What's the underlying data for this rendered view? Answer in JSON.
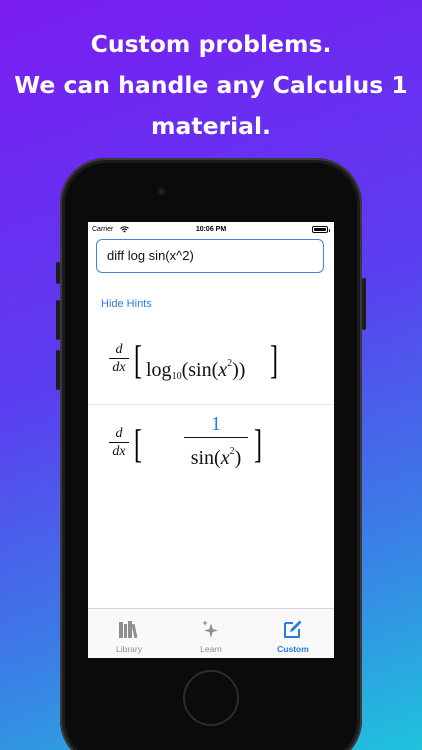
{
  "headline": {
    "line1": "Custom problems.",
    "line2": "We can handle any Calculus 1",
    "line3": "material."
  },
  "status_bar": {
    "carrier": "Carrier",
    "time": "10:06 PM"
  },
  "input": {
    "value": "diff log sin(x^2)"
  },
  "hints_toggle": "Hide Hints",
  "problem": {
    "d": "d",
    "dx": "dx",
    "log": "log",
    "base": "10",
    "sin_open": "(sin(",
    "x": "x",
    "exp": "2",
    "close": "))"
  },
  "hint": {
    "d": "d",
    "dx": "dx",
    "numerator": "1",
    "den_sin": "sin(",
    "x": "x",
    "exp": "2",
    "close": ")"
  },
  "tabs": [
    {
      "label": "Library",
      "icon": "library-icon",
      "active": false
    },
    {
      "label": "Learn",
      "icon": "sparkles-icon",
      "active": false
    },
    {
      "label": "Custom",
      "icon": "compose-icon",
      "active": true
    }
  ],
  "colors": {
    "accent": "#2a7ae8",
    "inactive": "#8e8e93"
  }
}
